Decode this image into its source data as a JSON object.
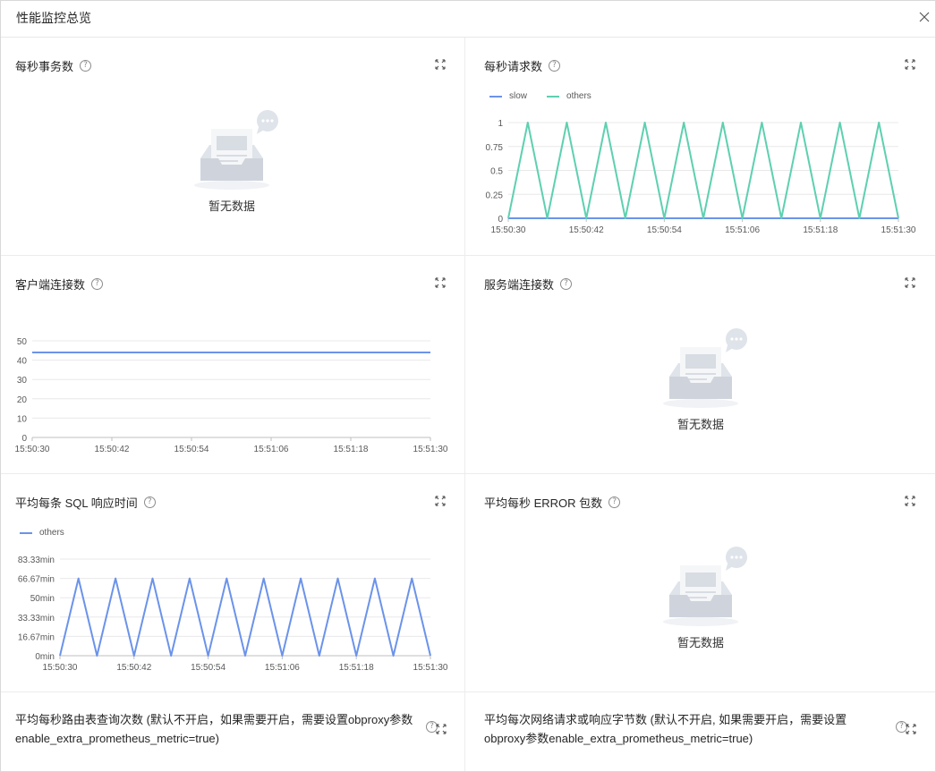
{
  "window": {
    "title": "性能监控总览"
  },
  "empty_text": "暂无数据",
  "colors": {
    "blue": "#6b93ea",
    "green": "#5ed0b0",
    "grid": "#e8e8e8",
    "axis": "#bfbfbf"
  },
  "panels": {
    "tps": {
      "title": "每秒事务数"
    },
    "qps": {
      "title": "每秒请求数"
    },
    "client_conn": {
      "title": "客户端连接数"
    },
    "server_conn": {
      "title": "服务端连接数"
    },
    "sql_rt": {
      "title": "平均每条 SQL 响应时间"
    },
    "error_pkt": {
      "title": "平均每秒 ERROR 包数"
    },
    "route_query": {
      "title": "平均每秒路由表查询次数 (默认不开启，如果需要开启，需要设置obproxy参数enable_extra_prometheus_metric=true)"
    },
    "net_bytes": {
      "title": "平均每次网络请求或响应字节数 (默认不开启, 如果需要开启，需要设置obproxy参数enable_extra_prometheus_metric=true)"
    }
  },
  "chart_data": [
    {
      "id": "qps",
      "type": "line",
      "x": [
        "15:50:30",
        "15:50:33",
        "15:50:36",
        "15:50:39",
        "15:50:42",
        "15:50:45",
        "15:50:48",
        "15:50:51",
        "15:50:54",
        "15:50:57",
        "15:51:00",
        "15:51:03",
        "15:51:06",
        "15:51:09",
        "15:51:12",
        "15:51:15",
        "15:51:18",
        "15:51:21",
        "15:51:24",
        "15:51:27",
        "15:51:30"
      ],
      "xticks": [
        "15:50:30",
        "15:50:42",
        "15:50:54",
        "15:51:06",
        "15:51:18",
        "15:51:30"
      ],
      "yticks": [
        "0",
        "0.25",
        "0.5",
        "0.75",
        "1"
      ],
      "ylim": [
        0,
        1
      ],
      "series": [
        {
          "name": "slow",
          "color": "#6b93ea",
          "values": [
            0,
            0,
            0,
            0,
            0,
            0,
            0,
            0,
            0,
            0,
            0,
            0,
            0,
            0,
            0,
            0,
            0,
            0,
            0,
            0,
            0
          ]
        },
        {
          "name": "others",
          "color": "#5ed0b0",
          "values": [
            0,
            1,
            0,
            1,
            0,
            1,
            0,
            1,
            0,
            1,
            0,
            1,
            0,
            1,
            0,
            1,
            0,
            1,
            0,
            1,
            0
          ]
        }
      ]
    },
    {
      "id": "client_conn",
      "type": "line",
      "x": [
        "15:50:30",
        "15:50:42",
        "15:50:54",
        "15:51:06",
        "15:51:18",
        "15:51:30"
      ],
      "xticks": [
        "15:50:30",
        "15:50:42",
        "15:50:54",
        "15:51:06",
        "15:51:18",
        "15:51:30"
      ],
      "yticks": [
        "0",
        "10",
        "20",
        "30",
        "40",
        "50"
      ],
      "ylim": [
        0,
        50
      ],
      "series": [
        {
          "name": "",
          "color": "#6b93ea",
          "values": [
            44,
            44,
            44,
            44,
            44,
            44
          ]
        }
      ]
    },
    {
      "id": "sql_rt",
      "type": "line",
      "x": [
        "15:50:30",
        "15:50:33",
        "15:50:36",
        "15:50:39",
        "15:50:42",
        "15:50:45",
        "15:50:48",
        "15:50:51",
        "15:50:54",
        "15:50:57",
        "15:51:00",
        "15:51:03",
        "15:51:06",
        "15:51:09",
        "15:51:12",
        "15:51:15",
        "15:51:18",
        "15:51:21",
        "15:51:24",
        "15:51:27",
        "15:51:30"
      ],
      "xticks": [
        "15:50:30",
        "15:50:42",
        "15:50:54",
        "15:51:06",
        "15:51:18",
        "15:51:30"
      ],
      "yticks": [
        "0min",
        "16.67min",
        "33.33min",
        "50min",
        "66.67min",
        "83.33min"
      ],
      "ylim": [
        0,
        83.33
      ],
      "series": [
        {
          "name": "others",
          "color": "#6b93ea",
          "values": [
            0,
            66.67,
            0,
            66.67,
            0,
            66.67,
            0,
            66.67,
            0,
            66.67,
            0,
            66.67,
            0,
            66.67,
            0,
            66.67,
            0,
            66.67,
            0,
            66.67,
            0
          ]
        }
      ]
    }
  ]
}
